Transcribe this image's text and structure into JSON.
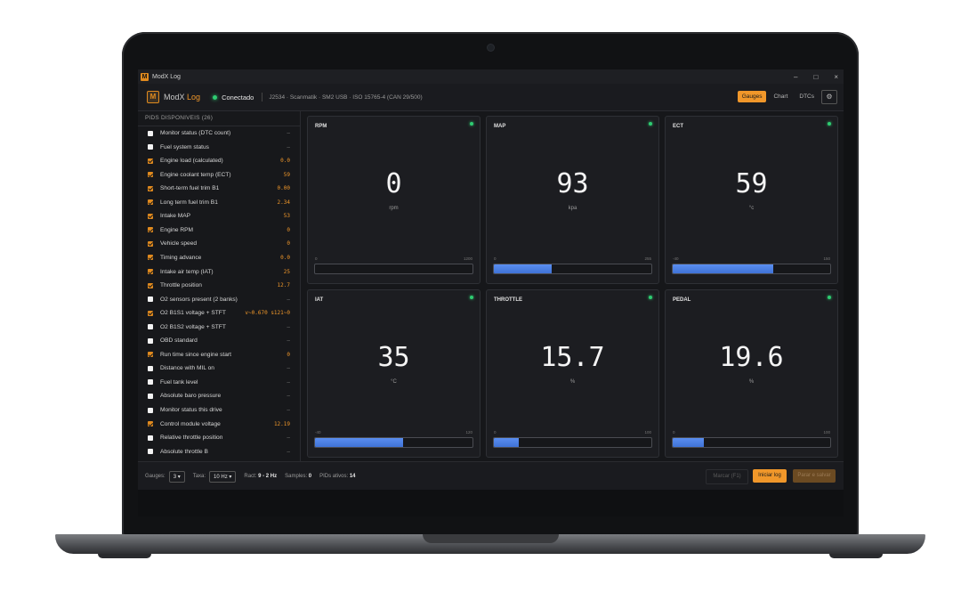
{
  "app": {
    "window_title": "ModX Log",
    "logo_letter": "M",
    "brand_main": "ModX",
    "brand_accent": "Log",
    "connection_status": "Conectado",
    "protocol": "J2534 · Scanmatik · SM2 USB · ISO 15765-4 (CAN 29/500)",
    "window_controls": {
      "minimize": "–",
      "maximize": "□",
      "close": "×"
    }
  },
  "tabs": [
    {
      "label": "Gauges",
      "active": true
    },
    {
      "label": "Chart",
      "active": false
    },
    {
      "label": "DTCs",
      "active": false
    }
  ],
  "sidebar": {
    "title": "PIDS DISPONIVEIS (26)",
    "items": [
      {
        "label": "Monitor status (DTC count)",
        "checked": false,
        "value": "—"
      },
      {
        "label": "Fuel system status",
        "checked": false,
        "value": "—"
      },
      {
        "label": "Engine load (calculated)",
        "checked": true,
        "value": "0.0"
      },
      {
        "label": "Engine coolant temp (ECT)",
        "checked": true,
        "value": "59"
      },
      {
        "label": "Short-term fuel trim B1",
        "checked": true,
        "value": "0.00"
      },
      {
        "label": "Long term fuel trim B1",
        "checked": true,
        "value": "2.34"
      },
      {
        "label": "Intake MAP",
        "checked": true,
        "value": "53"
      },
      {
        "label": "Engine RPM",
        "checked": true,
        "value": "0"
      },
      {
        "label": "Vehicle speed",
        "checked": true,
        "value": "0"
      },
      {
        "label": "Timing advance",
        "checked": true,
        "value": "0.0"
      },
      {
        "label": "Intake air temp (IAT)",
        "checked": true,
        "value": "25"
      },
      {
        "label": "Throttle position",
        "checked": true,
        "value": "12.7"
      },
      {
        "label": "O2 sensors present (2 banks)",
        "checked": false,
        "value": "—"
      },
      {
        "label": "O2 B1S1 voltage + STFT",
        "checked": true,
        "value": "v~0.670 s121~0"
      },
      {
        "label": "O2 B1S2 voltage + STFT",
        "checked": false,
        "value": "—"
      },
      {
        "label": "OBD standard",
        "checked": false,
        "value": "—"
      },
      {
        "label": "Run time since engine start",
        "checked": true,
        "value": "0"
      },
      {
        "label": "Distance with MIL on",
        "checked": false,
        "value": "—"
      },
      {
        "label": "Fuel tank level",
        "checked": false,
        "value": "—"
      },
      {
        "label": "Absolute baro pressure",
        "checked": false,
        "value": "—"
      },
      {
        "label": "Monitor status this drive",
        "checked": false,
        "value": "—"
      },
      {
        "label": "Control module voltage",
        "checked": true,
        "value": "12.19"
      },
      {
        "label": "Relative throttle position",
        "checked": false,
        "value": "—"
      },
      {
        "label": "Absolute throttle B",
        "checked": false,
        "value": "—"
      }
    ]
  },
  "gauges": [
    {
      "title": "RPM",
      "value": "0",
      "unit": "rpm",
      "min": "0",
      "max": "1200",
      "fill": 0.0
    },
    {
      "title": "MAP",
      "value": "93",
      "unit": "kpa",
      "min": "0",
      "max": "255",
      "fill": 0.37
    },
    {
      "title": "ECT",
      "value": "59",
      "unit": "°c",
      "min": "-40",
      "max": "150",
      "fill": 0.64
    },
    {
      "title": "IAT",
      "value": "35",
      "unit": "°C",
      "min": "-40",
      "max": "120",
      "fill": 0.56
    },
    {
      "title": "THROTTLE",
      "value": "15.7",
      "unit": "%",
      "min": "0",
      "max": "100",
      "fill": 0.16
    },
    {
      "title": "PEDAL",
      "value": "19.6",
      "unit": "%",
      "min": "0",
      "max": "100",
      "fill": 0.2
    }
  ],
  "footer": {
    "gauges_label": "Gauges:",
    "gauges_value": "3 ▾",
    "rate_label": "Taxa:",
    "rate_value": "10 Hz ▾",
    "real_label": "Ract:",
    "real_value": "9 - 2 Hz",
    "samples_label": "Samples:",
    "samples_value": "0",
    "pids_label": "PIDs ativos:",
    "pids_value": "14",
    "btn_mark": "Marcar (F1)",
    "btn_start": "Iniciar log",
    "btn_export": "Parar e salvar"
  },
  "colors": {
    "accent": "#f0972a",
    "status_ok": "#2ecc71",
    "bar_fill": "#4a7fe4",
    "panel": "#1c1d21"
  },
  "icons": {
    "settings": "gear-icon",
    "connection": "status-dot-icon"
  }
}
